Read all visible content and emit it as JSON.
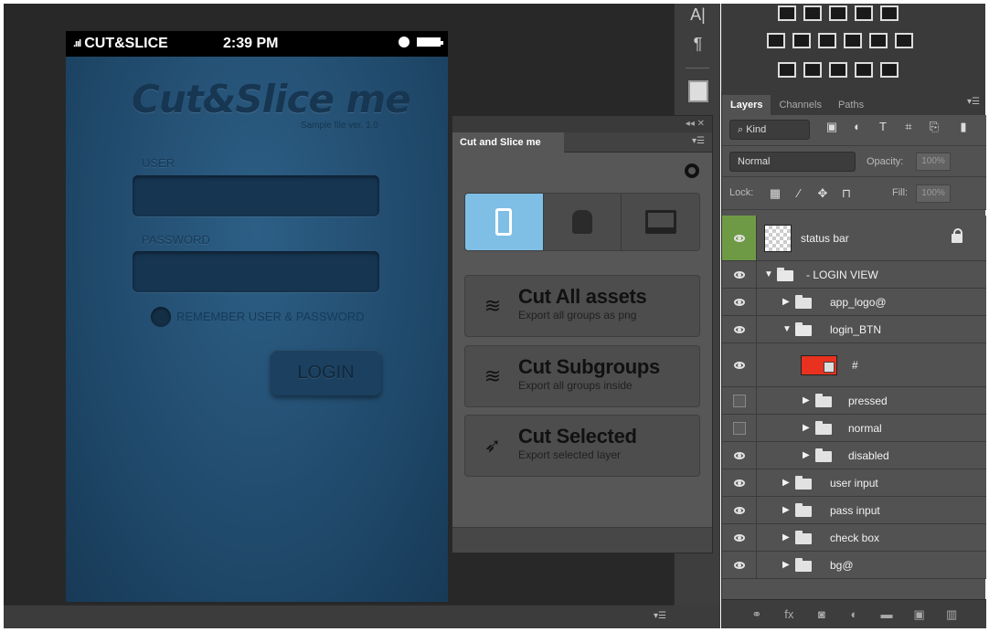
{
  "phone": {
    "carrier": "CUT&SLICE",
    "signal": ".ııl",
    "time": "2:39 PM",
    "app_logo": "Cut&Slice me",
    "version": "Sample file ver. 1.0",
    "user_label": "USER",
    "password_label": "PASSWORD",
    "remember_label": "REMEMBER USER & PASSWORD",
    "login_label": "LOGIN"
  },
  "tool_strip": {
    "character_icon": "A|",
    "paragraph_icon": "¶"
  },
  "plugin": {
    "topbar_controls": "◂◂  ✕",
    "tab_label": "Cut and Slice me",
    "platforms": [
      {
        "name": "iOS",
        "icon": "phone-icon",
        "active": true
      },
      {
        "name": "Android",
        "icon": "android-icon",
        "active": false
      },
      {
        "name": "Desktop",
        "icon": "monitor-icon",
        "active": false
      }
    ],
    "actions": [
      {
        "title": "Cut All assets",
        "subtitle": "Export all groups as png",
        "icon": "layers-stack-icon"
      },
      {
        "title": "Cut Subgroups",
        "subtitle": "Export all groups inside",
        "icon": "layers-sub-icon"
      },
      {
        "title": "Cut Selected",
        "subtitle": "Export selected layer",
        "icon": "cursor-select-icon"
      }
    ]
  },
  "layers_panel": {
    "tabs": [
      "Layers",
      "Channels",
      "Paths"
    ],
    "active_tab": "Layers",
    "kind_label": "Kind",
    "blend_mode": "Normal",
    "opacity_label": "Opacity:",
    "opacity_value": "100%",
    "lock_label": "Lock:",
    "fill_label": "Fill:",
    "fill_value": "100%",
    "layers": [
      {
        "name": "status bar",
        "type": "layer",
        "visible": true,
        "locked": true
      },
      {
        "name": "- LOGIN VIEW",
        "type": "group",
        "expanded": true,
        "visible": true
      },
      {
        "name": "app_logo@",
        "type": "group",
        "expanded": false,
        "visible": true
      },
      {
        "name": "login_BTN",
        "type": "group",
        "expanded": true,
        "visible": true
      },
      {
        "name": "#",
        "type": "layer",
        "visible": true
      },
      {
        "name": "pressed",
        "type": "group",
        "expanded": false,
        "visible": false
      },
      {
        "name": "normal",
        "type": "group",
        "expanded": false,
        "visible": false
      },
      {
        "name": "disabled",
        "type": "group",
        "expanded": false,
        "visible": true
      },
      {
        "name": "user input",
        "type": "group",
        "expanded": false,
        "visible": true
      },
      {
        "name": "pass input",
        "type": "group",
        "expanded": false,
        "visible": true
      },
      {
        "name": "check box",
        "type": "group",
        "expanded": false,
        "visible": true
      },
      {
        "name": "bg@",
        "type": "group",
        "expanded": false,
        "visible": true
      }
    ]
  },
  "colors": {
    "active_platform": "#7fbfe6",
    "status_bar_vis": "#6f9a45",
    "red_thumb": "#e8321f"
  }
}
